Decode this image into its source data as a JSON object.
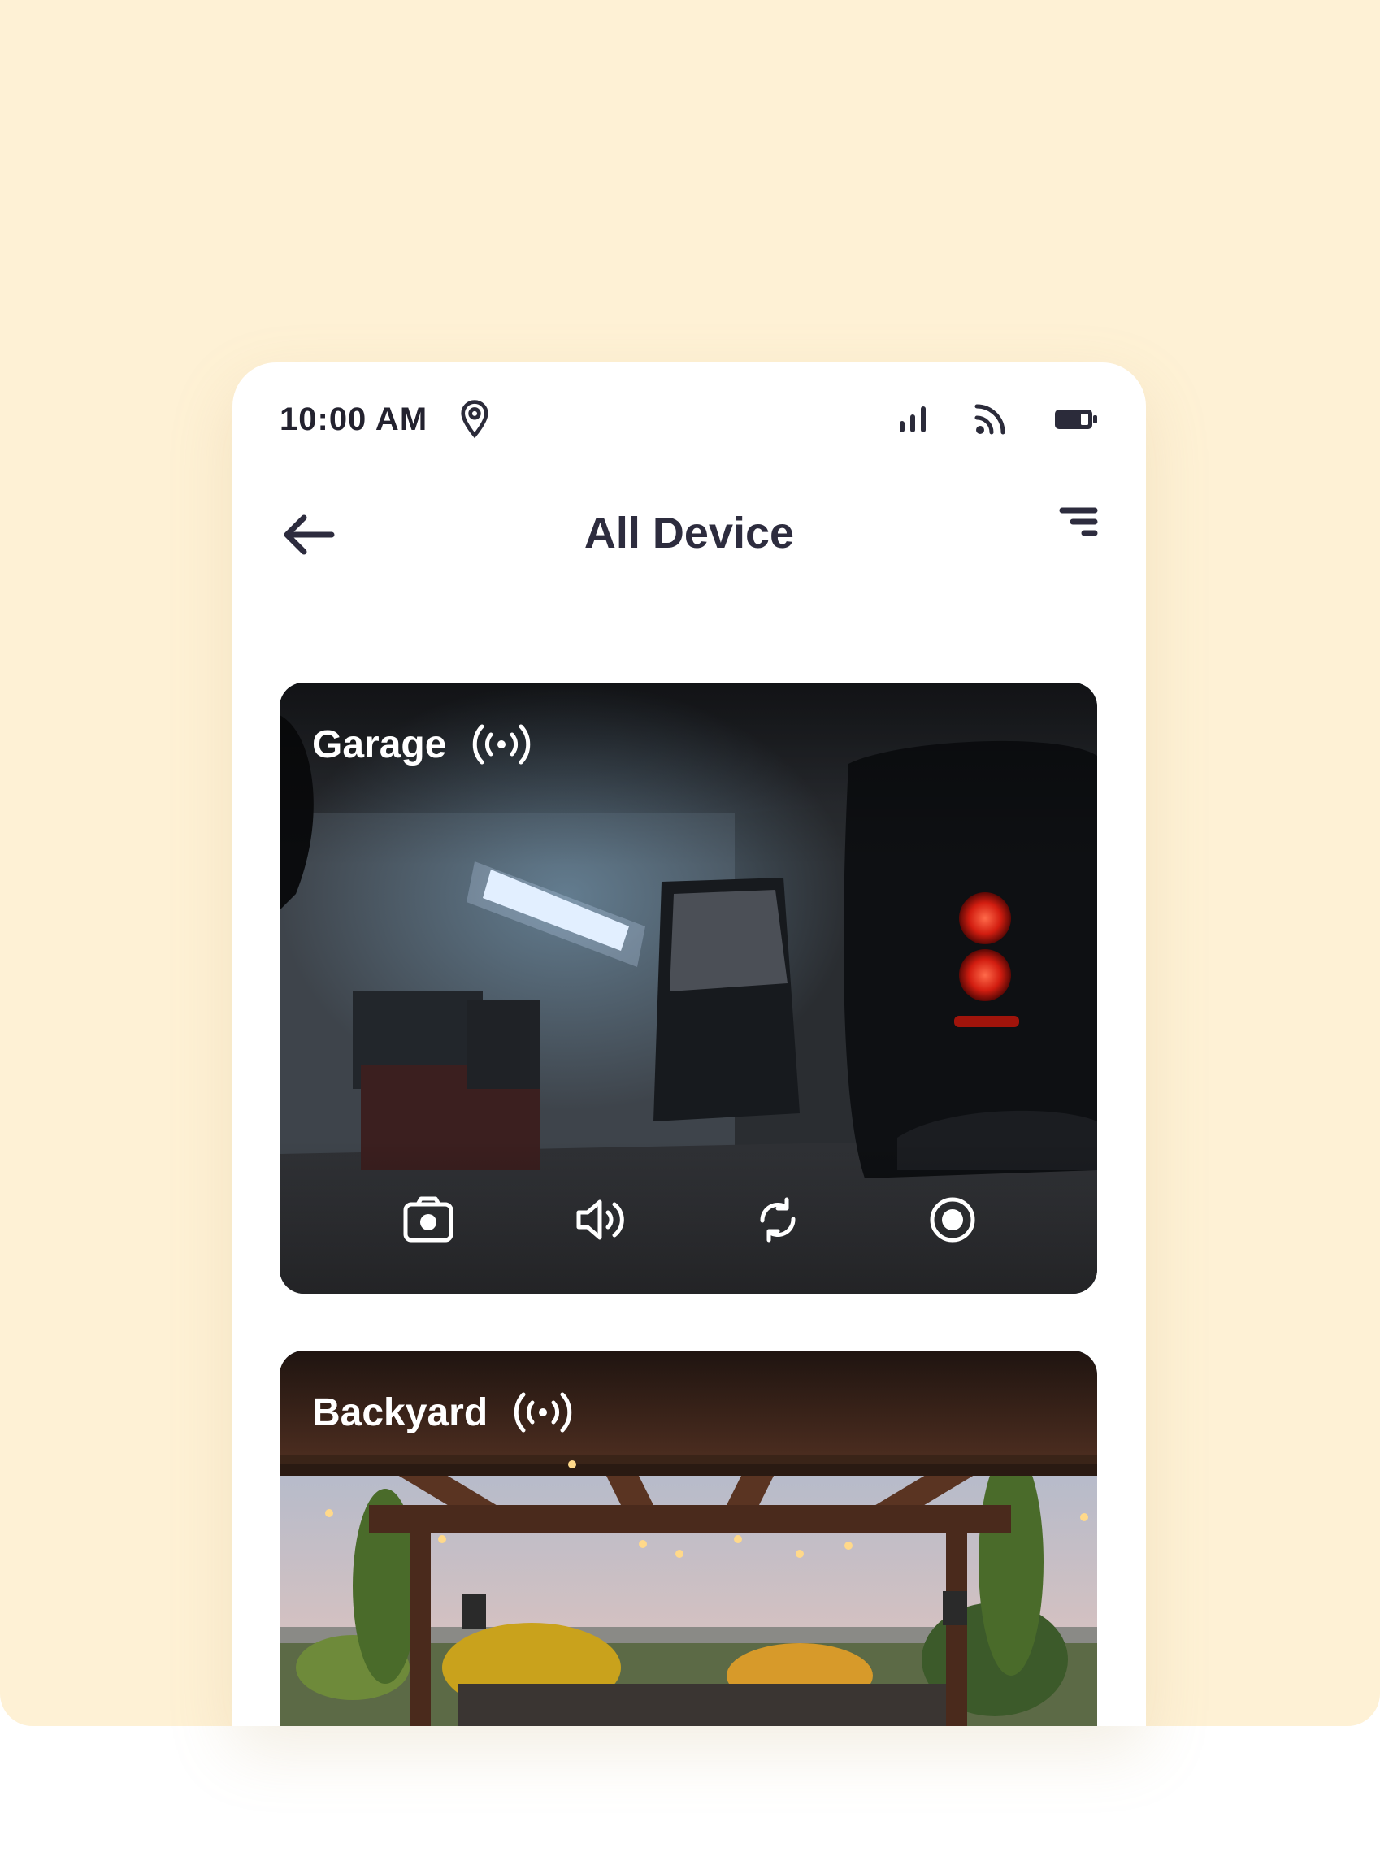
{
  "status_bar": {
    "time": "10:00 AM"
  },
  "header": {
    "title": "All Device"
  },
  "devices": [
    {
      "name": "Garage"
    },
    {
      "name": "Backyard"
    }
  ],
  "icons": {
    "status": [
      "location-pin-icon",
      "signal-bars-icon",
      "wifi-icon",
      "battery-icon"
    ],
    "header": [
      "back-arrow-icon",
      "filter-icon"
    ],
    "card": [
      "live-broadcast-icon"
    ],
    "controls": [
      "camera-icon",
      "speaker-icon",
      "rotate-icon",
      "record-icon"
    ]
  },
  "colors": {
    "backdrop": "#fef1d5",
    "text_dark": "#2d2c3e",
    "card_text": "#ffffff"
  }
}
